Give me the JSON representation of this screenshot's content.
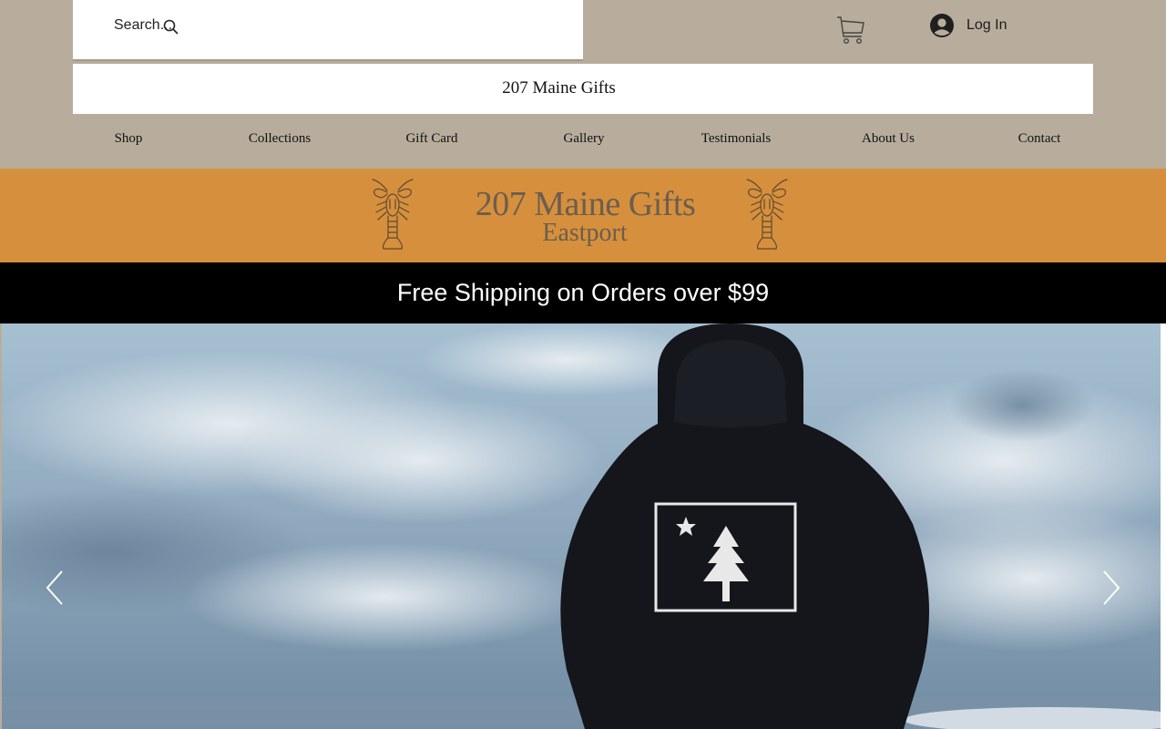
{
  "search": {
    "placeholder": "Search..."
  },
  "account": {
    "login_label": "Log In"
  },
  "site": {
    "title": "207 Maine Gifts"
  },
  "nav": {
    "items": [
      "Shop",
      "Collections",
      "Gift Card",
      "Gallery",
      "Testimonials",
      "About Us",
      "Contact"
    ]
  },
  "banner": {
    "title": "207 Maine Gifts",
    "subtitle": "Eastport"
  },
  "promo": {
    "text": "Free Shipping on Orders over $99"
  },
  "icons": {
    "search": "search-icon",
    "cart": "cart-icon",
    "avatar": "avatar-icon",
    "lobster": "lobster-icon",
    "prev": "chevron-left-icon",
    "next": "chevron-right-icon"
  },
  "colors": {
    "header_bg": "#b8ad9c",
    "banner_bg": "#d68f3d",
    "banner_text": "#6b5e4e",
    "promo_bg": "#000000",
    "promo_text": "#ffffff"
  }
}
